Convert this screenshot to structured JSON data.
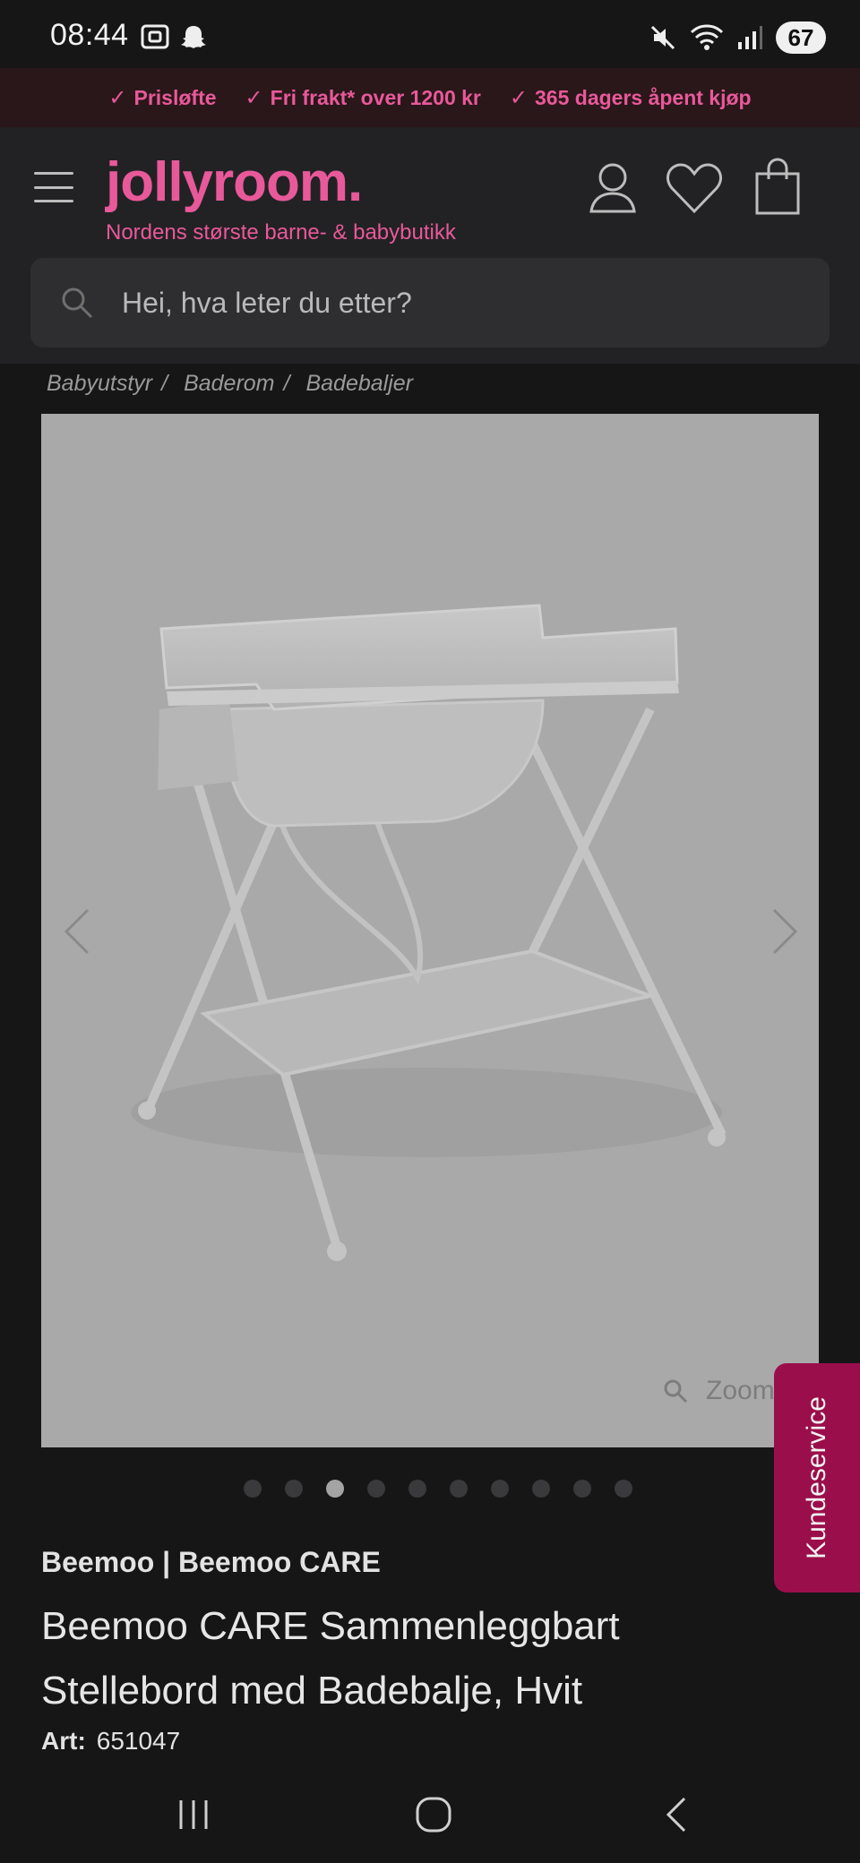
{
  "status_bar": {
    "time": "08:44",
    "battery": "67",
    "icons": [
      "screenshot-icon",
      "snapchat-icon",
      "mute-icon",
      "wifi-icon",
      "signal-icon"
    ]
  },
  "promo": {
    "items": [
      "Prisløfte",
      "Fri frakt* over 1200 kr",
      "365 dagers åpent kjøp"
    ]
  },
  "header": {
    "logo": "jollyroom.",
    "tagline": "Nordens største barne- & babybutikk"
  },
  "search": {
    "placeholder": "Hei, hva leter du etter?"
  },
  "breadcrumb": {
    "items": [
      "Babyutstyr",
      "Baderom",
      "Badebaljer"
    ]
  },
  "gallery": {
    "zoom_label": "Zoom",
    "dot_count": 10,
    "active_index": 2
  },
  "product": {
    "brand": "Beemoo | Beemoo CARE",
    "title": "Beemoo CARE Sammenleggbart Stellebord med Badebalje, Hvit",
    "art_label": "Art:",
    "art_number": "651047"
  },
  "customer_service": {
    "label": "Kundeservice"
  },
  "colors": {
    "brand_pink": "#e8599a",
    "service_tab": "#9a0f4b"
  }
}
